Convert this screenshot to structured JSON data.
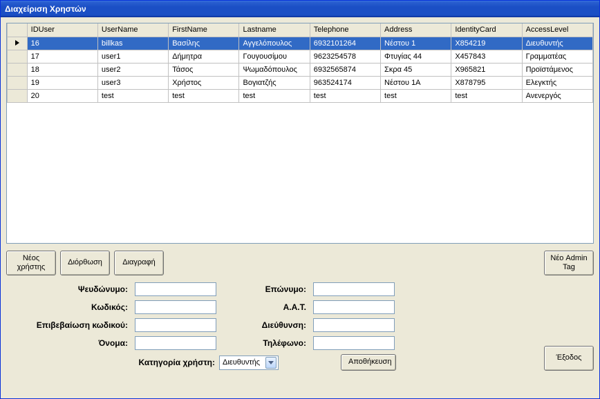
{
  "window": {
    "title": "Διαχείριση Χρηστών"
  },
  "grid": {
    "columns": [
      "IDUser",
      "UserName",
      "FirstName",
      "Lastname",
      "Telephone",
      "Address",
      "IdentityCard",
      "AccessLevel"
    ],
    "rows": [
      {
        "selected": true,
        "cells": [
          "16",
          "billkas",
          "Βασίλης",
          "Αγγελόπουλος",
          "6932101264",
          "Νέστου 1",
          "X854219",
          "Διευθυντής"
        ]
      },
      {
        "selected": false,
        "cells": [
          "17",
          "user1",
          "Δήμητρα",
          "Γουγουσίμου",
          "9623254578",
          "Φτυγίας 44",
          "X457843",
          "Γραμματέας"
        ]
      },
      {
        "selected": false,
        "cells": [
          "18",
          "user2",
          "Τάσος",
          "Ψωμαδόπουλος",
          "6932565874",
          "Σκρα 45",
          "X965821",
          "Προϊστάμενος"
        ]
      },
      {
        "selected": false,
        "cells": [
          "19",
          "user3",
          "Χρήστος",
          "Βογιατζής",
          "963524174",
          "Νέστου 1Α",
          "X878795",
          "Ελεγκτής"
        ]
      },
      {
        "selected": false,
        "cells": [
          "20",
          "test",
          "test",
          "test",
          "test",
          "test",
          "test",
          "Ανενεργός"
        ]
      }
    ]
  },
  "buttons": {
    "new_user": "Νέος\nχρήστης",
    "edit": "Διόρθωση",
    "delete": "Διαγραφή",
    "admin_tag": "Νέο Admin\nTag",
    "save": "Αποθήκευση",
    "exit": "Έξοδος"
  },
  "form": {
    "labels": {
      "username": "Ψευδώνυμο:",
      "password": "Κωδικός:",
      "confirm": "Επιβεβαίωση κωδικού:",
      "firstname": "Όνομα:",
      "lastname": "Επώνυμο:",
      "idcard": "Α.Α.Τ.",
      "address": "Διεύθυνση:",
      "phone": "Τηλέφωνο:",
      "category": "Κατηγορία χρήστη:"
    },
    "values": {
      "username": "",
      "password": "",
      "confirm": "",
      "firstname": "",
      "lastname": "",
      "idcard": "",
      "address": "",
      "phone": "",
      "category": "Διευθυντής"
    }
  }
}
